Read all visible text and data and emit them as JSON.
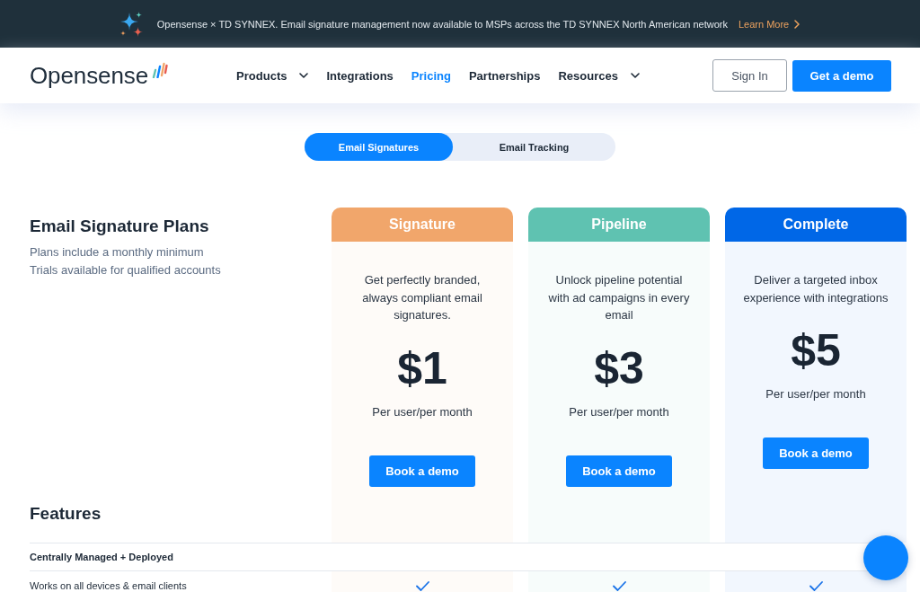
{
  "announcement": {
    "text": "Opensense × TD SYNNEX. Email signature management now available to MSPs across the TD SYNNEX North American network",
    "link": "Learn More"
  },
  "nav": {
    "logo": "Opensense",
    "items": [
      {
        "label": "Products",
        "dropdown": true,
        "selected": false
      },
      {
        "label": "Integrations",
        "dropdown": false,
        "selected": false
      },
      {
        "label": "Pricing",
        "dropdown": false,
        "selected": true
      },
      {
        "label": "Partnerships",
        "dropdown": false,
        "selected": false
      },
      {
        "label": "Resources",
        "dropdown": true,
        "selected": false
      }
    ],
    "buttons": [
      {
        "label": "Sign In",
        "kind": "outline"
      },
      {
        "label": "Get a demo",
        "kind": "primary"
      }
    ]
  },
  "product_tabs": [
    {
      "label": "Email Signatures",
      "selected": true
    },
    {
      "label": "Email Tracking",
      "selected": false
    }
  ],
  "intro": {
    "title": "Email Signature Plans",
    "notes": [
      "Plans include a monthly minimum",
      "Trials available for qualified accounts"
    ]
  },
  "plans": [
    {
      "name": "Signature",
      "color": "#f1a66b",
      "description": "Get perfectly branded, always compliant email signatures.",
      "price": "$1",
      "unit": "Per user/per month",
      "button": "Book a demo"
    },
    {
      "name": "Pipeline",
      "color": "#5fc2b1",
      "description": "Unlock pipeline potential with ad campaigns in every email",
      "price": "$3",
      "unit": "Per user/per month",
      "button": "Book a demo"
    },
    {
      "name": "Complete",
      "color": "#0067e7",
      "description": "Deliver a targeted inbox experience with integrations",
      "price": "$5",
      "unit": "Per user/per month",
      "button": "Book a demo"
    }
  ],
  "features": {
    "title": "Features",
    "rows": [
      {
        "kind": "category",
        "label": "Centrally Managed + Deployed"
      },
      {
        "kind": "feature",
        "label": "Works on all devices & email clients",
        "included": [
          true,
          true,
          true
        ]
      }
    ]
  }
}
